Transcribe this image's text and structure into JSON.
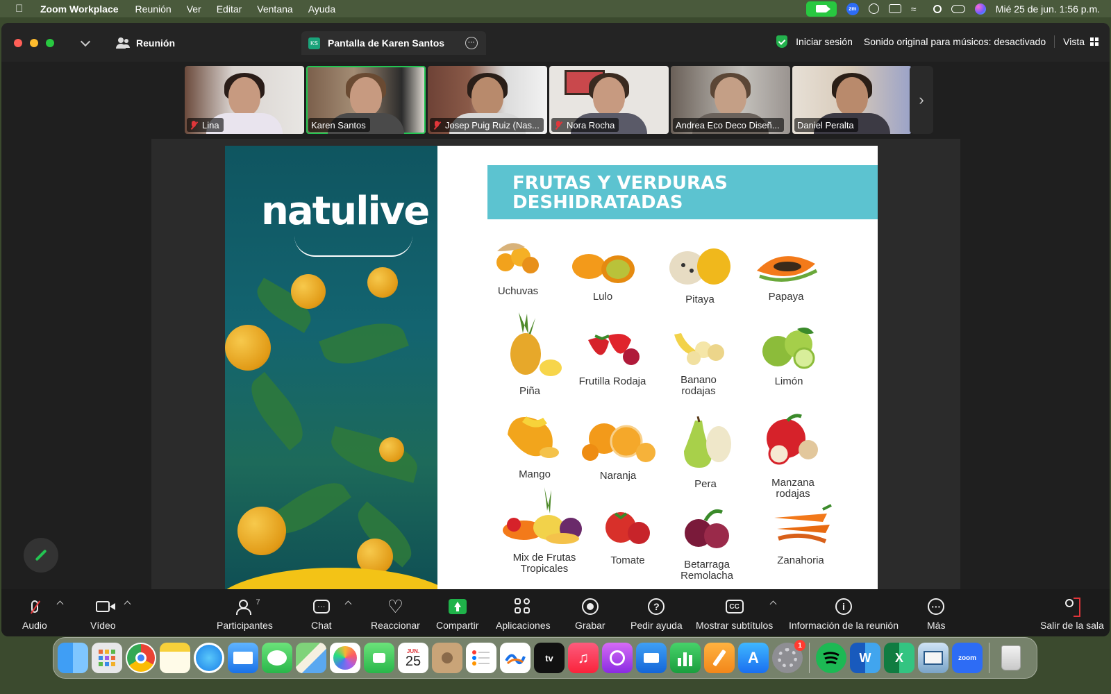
{
  "menubar": {
    "app_name": "Zoom Workplace",
    "items": [
      "Reunión",
      "Ver",
      "Editar",
      "Ventana",
      "Ayuda"
    ],
    "zoom_badge": "zm",
    "datetime": "Mié 25 de jun.  1:56 p.m."
  },
  "titlebar": {
    "meeting_tab": "Reunión",
    "share_badge": "KS",
    "share_tab": "Pantalla de Karen Santos",
    "signin": "Iniciar sesión",
    "original_sound": "Sonido original para músicos: desactivado",
    "view": "Vista"
  },
  "participants_strip": [
    {
      "name": "Lina",
      "muted": true,
      "active": false
    },
    {
      "name": "Karen Santos",
      "muted": false,
      "active": true
    },
    {
      "name": "Josep Puig Ruiz (Nas...",
      "muted": true,
      "active": false
    },
    {
      "name": "Nora Rocha",
      "muted": true,
      "active": false
    },
    {
      "name": "Andrea Eco Deco Diseñ...",
      "muted": false,
      "active": false
    },
    {
      "name": "Daniel Peralta",
      "muted": false,
      "active": false
    }
  ],
  "slide": {
    "logo": "natulive",
    "banner_line1": "FRUTAS Y VERDURAS",
    "banner_line2": "DESHIDRATADAS",
    "items": [
      "Uchuvas",
      "Lulo",
      "Pitaya",
      "Papaya",
      "Piña",
      "Frutilla Rodaja",
      "Banano rodajas",
      "Limón",
      "Mango",
      "Naranja",
      "Pera",
      "Manzana rodajas",
      "Mix de Frutas Tropicales",
      "Tomate",
      "Betarraga Remolacha",
      "Zanahoria"
    ]
  },
  "toolbar": {
    "audio": "Audio",
    "video": "Vídeo",
    "participants": "Participantes",
    "participants_count": "7",
    "chat": "Chat",
    "react": "Reaccionar",
    "share": "Compartir",
    "apps": "Aplicaciones",
    "record": "Grabar",
    "help": "Pedir ayuda",
    "captions": "Mostrar subtítulos",
    "cc": "CC",
    "info": "Información de la reunión",
    "more": "Más",
    "leave": "Salir de la sala"
  },
  "dock": {
    "calendar_month": "JUN.",
    "calendar_day": "25",
    "settings_badge": "1",
    "tv_label": "tv",
    "zoom_label": "zoom",
    "word_label": "W",
    "excel_label": "X"
  }
}
